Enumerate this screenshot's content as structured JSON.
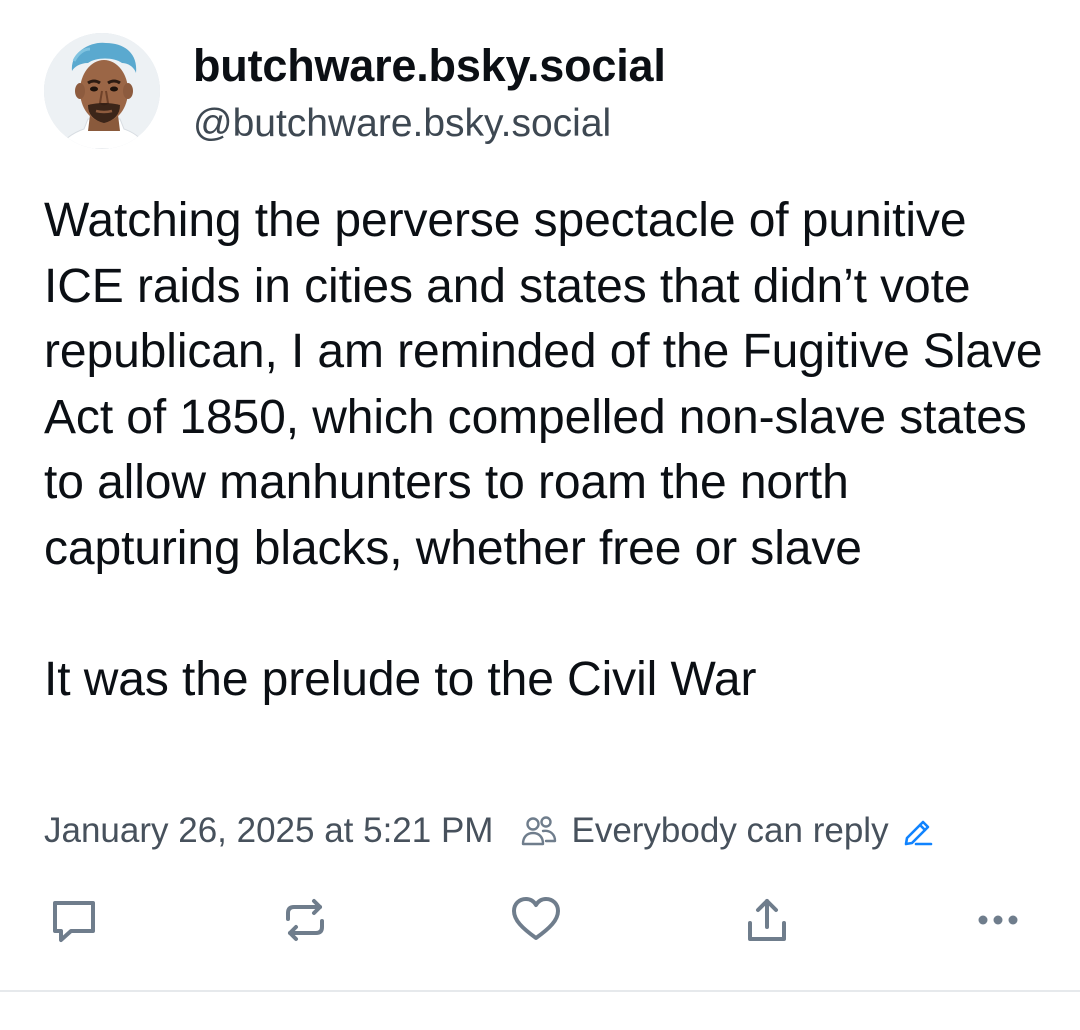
{
  "author": {
    "display_name": "butchware.bsky.social",
    "handle": "@butchware.bsky.social",
    "avatar_icon": "profile-photo"
  },
  "post": {
    "paragraphs": [
      "Watching the perverse spectacle of punitive ICE raids in cities and states that didn’t vote republican, I am reminded of the Fugitive Slave Act of 1850, which compelled non-slave states to allow manhunters to roam the north capturing blacks, whether free or slave",
      "It was the prelude to the Civil War"
    ]
  },
  "meta": {
    "timestamp": "January 26, 2025 at 5:21 PM",
    "reply_setting": "Everybody can reply",
    "people_icon": "people-icon",
    "edit_icon": "pencil-icon",
    "accent_color": "#1083fe"
  },
  "actions": [
    {
      "name": "reply",
      "icon": "comment-icon"
    },
    {
      "name": "repost",
      "icon": "repost-icon"
    },
    {
      "name": "like",
      "icon": "heart-icon"
    },
    {
      "name": "share",
      "icon": "share-icon"
    },
    {
      "name": "more",
      "icon": "more-icon"
    }
  ],
  "colors": {
    "text": "#0b0f14",
    "secondary_text": "#47515c",
    "icon": "#6f7d8c",
    "divider": "#e6e9ec"
  }
}
